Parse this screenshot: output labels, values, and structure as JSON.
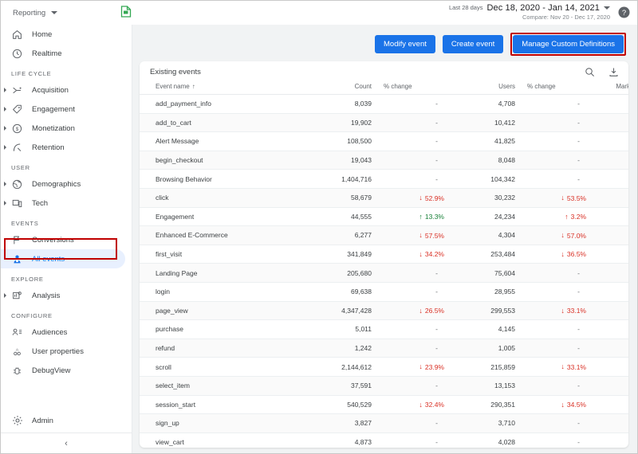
{
  "topbar": {
    "product_selector": "Reporting",
    "insights_icon": "insights-document-icon",
    "date_badge": "Last 28 days",
    "date_range": "Dec 18, 2020 - Jan 14, 2021",
    "compare": "Compare: Nov 20 - Dec 17, 2020",
    "help_icon": "help-circle-icon"
  },
  "sidebar": {
    "groups": [
      {
        "label": "",
        "items": [
          {
            "label": "Home",
            "icon": "home-icon",
            "expandable": false,
            "selected": false
          },
          {
            "label": "Realtime",
            "icon": "clock-icon",
            "expandable": false,
            "selected": false
          }
        ]
      },
      {
        "label": "LIFE CYCLE",
        "items": [
          {
            "label": "Acquisition",
            "icon": "acquisition-arrow-icon",
            "expandable": true,
            "selected": false
          },
          {
            "label": "Engagement",
            "icon": "tag-icon",
            "expandable": true,
            "selected": false
          },
          {
            "label": "Monetization",
            "icon": "dollar-circle-icon",
            "expandable": true,
            "selected": false
          },
          {
            "label": "Retention",
            "icon": "retention-curve-icon",
            "expandable": true,
            "selected": false
          }
        ]
      },
      {
        "label": "USER",
        "items": [
          {
            "label": "Demographics",
            "icon": "globe-icon",
            "expandable": true,
            "selected": false
          },
          {
            "label": "Tech",
            "icon": "devices-icon",
            "expandable": true,
            "selected": false
          }
        ]
      },
      {
        "label": "EVENTS",
        "items": [
          {
            "label": "Conversions",
            "icon": "flag-icon",
            "expandable": false,
            "selected": false
          },
          {
            "label": "All events",
            "icon": "all-events-icon",
            "expandable": false,
            "selected": true
          }
        ]
      },
      {
        "label": "EXPLORE",
        "items": [
          {
            "label": "Analysis",
            "icon": "analysis-icon",
            "expandable": true,
            "selected": false
          }
        ]
      },
      {
        "label": "CONFIGURE",
        "items": [
          {
            "label": "Audiences",
            "icon": "audiences-icon",
            "expandable": false,
            "selected": false
          },
          {
            "label": "User properties",
            "icon": "user-properties-icon",
            "expandable": false,
            "selected": false
          },
          {
            "label": "DebugView",
            "icon": "debug-icon",
            "expandable": false,
            "selected": false
          }
        ]
      }
    ],
    "admin": {
      "label": "Admin",
      "icon": "gear-icon"
    },
    "collapse_icon": "chevron-left-icon"
  },
  "toolbar": {
    "modify_event": "Modify event",
    "create_event": "Create event",
    "manage_custom_definitions": "Manage Custom Definitions"
  },
  "card": {
    "title": "Existing events",
    "search_icon": "search-icon",
    "download_icon": "download-icon",
    "columns": {
      "event_name": "Event name",
      "count": "Count",
      "count_change": "% change",
      "users": "Users",
      "users_change": "% change",
      "mark_as_conversion": "Mark as conversion"
    },
    "sort": {
      "column": "event_name",
      "direction": "asc",
      "glyph": "↑"
    },
    "rows": [
      {
        "name": "add_payment_info",
        "count": "8,039",
        "count_change": "-",
        "count_dir": "none",
        "users": "4,708",
        "users_change": "-",
        "users_dir": "none",
        "conversion": false,
        "disabled": false
      },
      {
        "name": "add_to_cart",
        "count": "19,902",
        "count_change": "-",
        "count_dir": "none",
        "users": "10,412",
        "users_change": "-",
        "users_dir": "none",
        "conversion": false,
        "disabled": false
      },
      {
        "name": "Alert Message",
        "count": "108,500",
        "count_change": "-",
        "count_dir": "none",
        "users": "41,825",
        "users_change": "-",
        "users_dir": "none",
        "conversion": false,
        "disabled": false
      },
      {
        "name": "begin_checkout",
        "count": "19,043",
        "count_change": "-",
        "count_dir": "none",
        "users": "8,048",
        "users_change": "-",
        "users_dir": "none",
        "conversion": false,
        "disabled": false
      },
      {
        "name": "Browsing Behavior",
        "count": "1,404,716",
        "count_change": "-",
        "count_dir": "none",
        "users": "104,342",
        "users_change": "-",
        "users_dir": "none",
        "conversion": false,
        "disabled": false
      },
      {
        "name": "click",
        "count": "58,679",
        "count_change": "52.9%",
        "count_dir": "down",
        "users": "30,232",
        "users_change": "53.5%",
        "users_dir": "down",
        "conversion": false,
        "disabled": false
      },
      {
        "name": "Engagement",
        "count": "44,555",
        "count_change": "13.3%",
        "count_dir": "up-green",
        "users": "24,234",
        "users_change": "3.2%",
        "users_dir": "up-red",
        "conversion": false,
        "disabled": false
      },
      {
        "name": "Enhanced E-Commerce",
        "count": "6,277",
        "count_change": "57.5%",
        "count_dir": "down",
        "users": "4,304",
        "users_change": "57.0%",
        "users_dir": "down",
        "conversion": false,
        "disabled": false
      },
      {
        "name": "first_visit",
        "count": "341,849",
        "count_change": "34.2%",
        "count_dir": "down",
        "users": "253,484",
        "users_change": "36.5%",
        "users_dir": "down",
        "conversion": false,
        "disabled": false
      },
      {
        "name": "Landing Page",
        "count": "205,680",
        "count_change": "-",
        "count_dir": "none",
        "users": "75,604",
        "users_change": "-",
        "users_dir": "none",
        "conversion": false,
        "disabled": false
      },
      {
        "name": "login",
        "count": "69,638",
        "count_change": "-",
        "count_dir": "none",
        "users": "28,955",
        "users_change": "-",
        "users_dir": "none",
        "conversion": false,
        "disabled": false
      },
      {
        "name": "page_view",
        "count": "4,347,428",
        "count_change": "26.5%",
        "count_dir": "down",
        "users": "299,553",
        "users_change": "33.1%",
        "users_dir": "down",
        "conversion": false,
        "disabled": false
      },
      {
        "name": "purchase",
        "count": "5,011",
        "count_change": "-",
        "count_dir": "none",
        "users": "4,145",
        "users_change": "-",
        "users_dir": "none",
        "conversion": false,
        "disabled": true
      },
      {
        "name": "refund",
        "count": "1,242",
        "count_change": "-",
        "count_dir": "none",
        "users": "1,005",
        "users_change": "-",
        "users_dir": "none",
        "conversion": false,
        "disabled": false
      },
      {
        "name": "scroll",
        "count": "2,144,612",
        "count_change": "23.9%",
        "count_dir": "down",
        "users": "215,859",
        "users_change": "33.1%",
        "users_dir": "down",
        "conversion": false,
        "disabled": false
      },
      {
        "name": "select_item",
        "count": "37,591",
        "count_change": "-",
        "count_dir": "none",
        "users": "13,153",
        "users_change": "-",
        "users_dir": "none",
        "conversion": false,
        "disabled": false
      },
      {
        "name": "session_start",
        "count": "540,529",
        "count_change": "32.4%",
        "count_dir": "down",
        "users": "290,351",
        "users_change": "34.5%",
        "users_dir": "down",
        "conversion": false,
        "disabled": false
      },
      {
        "name": "sign_up",
        "count": "3,827",
        "count_change": "-",
        "count_dir": "none",
        "users": "3,710",
        "users_change": "-",
        "users_dir": "none",
        "conversion": true,
        "disabled": false
      },
      {
        "name": "view_cart",
        "count": "4,873",
        "count_change": "-",
        "count_dir": "none",
        "users": "4,028",
        "users_change": "-",
        "users_dir": "none",
        "conversion": false,
        "disabled": false
      }
    ]
  },
  "colors": {
    "accent": "#1a73e8",
    "selected_bg": "#e8f0fe",
    "highlight": "#c00000",
    "down": "#d93025",
    "up": "#188038",
    "page_bg": "#f1f3f4"
  }
}
